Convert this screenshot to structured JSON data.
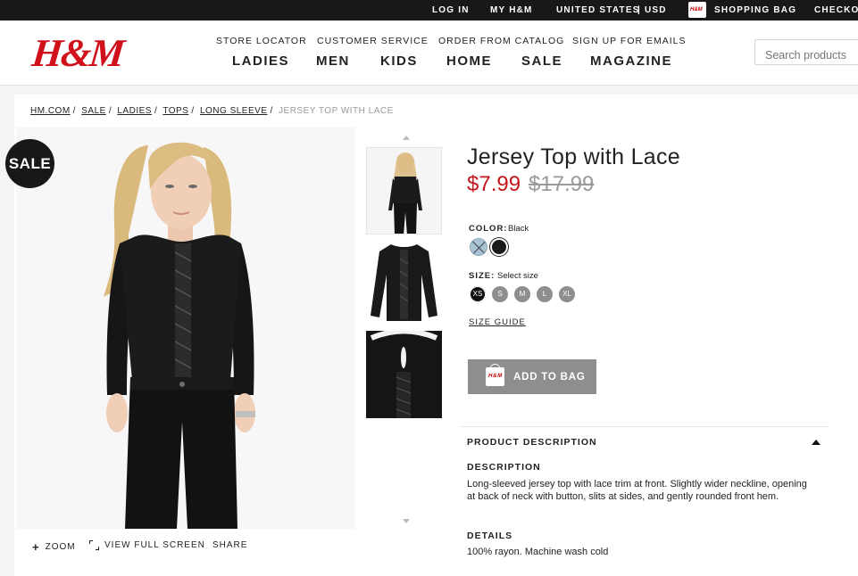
{
  "topbar": {
    "login": "LOG IN",
    "my_hm": "MY H&M",
    "region": "UNITED STATES",
    "currency": "| USD",
    "shopping_bag": "SHOPPING BAG",
    "checkout": "CHECKOUT"
  },
  "header": {
    "logo": "H&M",
    "util_links": [
      "STORE LOCATOR",
      "CUSTOMER SERVICE",
      "ORDER FROM CATALOG",
      "SIGN UP FOR EMAILS"
    ],
    "nav": [
      "LADIES",
      "MEN",
      "KIDS",
      "HOME",
      "SALE",
      "MAGAZINE"
    ],
    "search_placeholder": "Search products"
  },
  "breadcrumb": {
    "items": [
      "HM.COM",
      "SALE",
      "LADIES",
      "TOPS",
      "LONG SLEEVE"
    ],
    "current": "JERSEY TOP WITH LACE"
  },
  "gallery": {
    "sale_badge": "SALE",
    "zoom": "ZOOM",
    "fullscreen": "VIEW FULL SCREEN",
    "share": "SHARE"
  },
  "product": {
    "title": "Jersey Top with Lace",
    "price": "$7.99",
    "old_price": "$17.99",
    "color_label": "COLOR:",
    "color_value": "Black",
    "size_label": "SIZE:",
    "size_value": "Select size",
    "sizes": [
      "XS",
      "S",
      "M",
      "L",
      "XL"
    ],
    "size_guide": "SIZE GUIDE",
    "add_to_bag": "ADD TO BAG",
    "colors": {
      "swatch_1": "#a8c4d4",
      "swatch_2": "#1a1a1a",
      "price_red": "#c4161c"
    }
  },
  "description": {
    "section_title": "PRODUCT DESCRIPTION",
    "desc_title": "DESCRIPTION",
    "desc_text": "Long-sleeved jersey top with lace trim at front. Slightly wider neckline, opening at back of neck with button, slits at sides, and gently rounded front hem.",
    "details_title": "DETAILS",
    "details_text": "100% rayon. Machine wash cold"
  }
}
